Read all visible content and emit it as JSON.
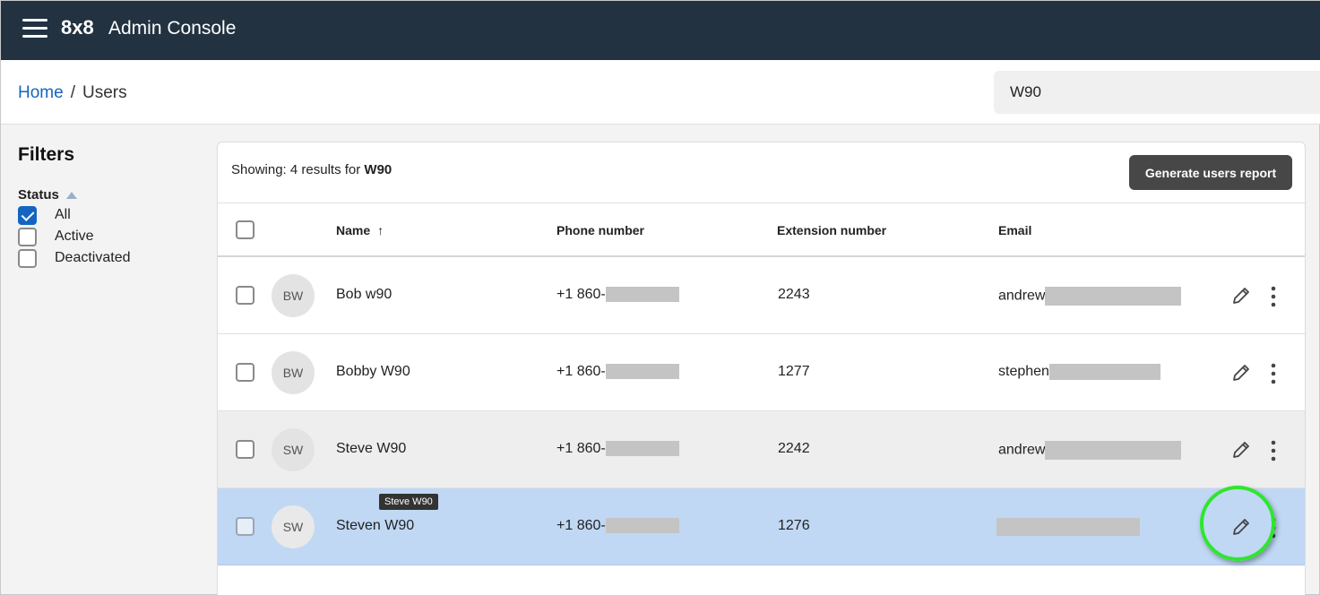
{
  "header": {
    "brand": "8x8",
    "title": "Admin Console"
  },
  "breadcrumb": {
    "home": "Home",
    "separator": "/",
    "current": "Users"
  },
  "search": {
    "value": "W90"
  },
  "filters": {
    "title": "Filters",
    "status_label": "Status",
    "options": [
      {
        "label": "All",
        "checked": true
      },
      {
        "label": "Active",
        "checked": false
      },
      {
        "label": "Deactivated",
        "checked": false
      }
    ]
  },
  "results": {
    "prefix": "Showing: 4 results for ",
    "query": "W90",
    "report_button": "Generate users report"
  },
  "table": {
    "columns": {
      "name": "Name",
      "sort_arrow": "↑",
      "phone": "Phone number",
      "extension": "Extension number",
      "email": "Email"
    },
    "rows": [
      {
        "initials": "BW",
        "name": "Bob w90",
        "phone": "+1 860-",
        "extension": "2243",
        "email": "andrew"
      },
      {
        "initials": "BW",
        "name": "Bobby W90",
        "phone": "+1 860-",
        "extension": "1277",
        "email": "stephen"
      },
      {
        "initials": "SW",
        "name": "Steve W90",
        "phone": "+1 860-",
        "extension": "2242",
        "email": "andrew"
      },
      {
        "initials": "SW",
        "name": "Steven W90",
        "phone": "+1 860-",
        "extension": "1276",
        "email": ""
      }
    ],
    "tooltip": "Steve W90"
  },
  "colors": {
    "topbar": "#223241",
    "link": "#1565c0",
    "row_hover": "#eeeeee",
    "row_selected": "#c0d8f4",
    "highlight_ring": "#2ee62e"
  }
}
